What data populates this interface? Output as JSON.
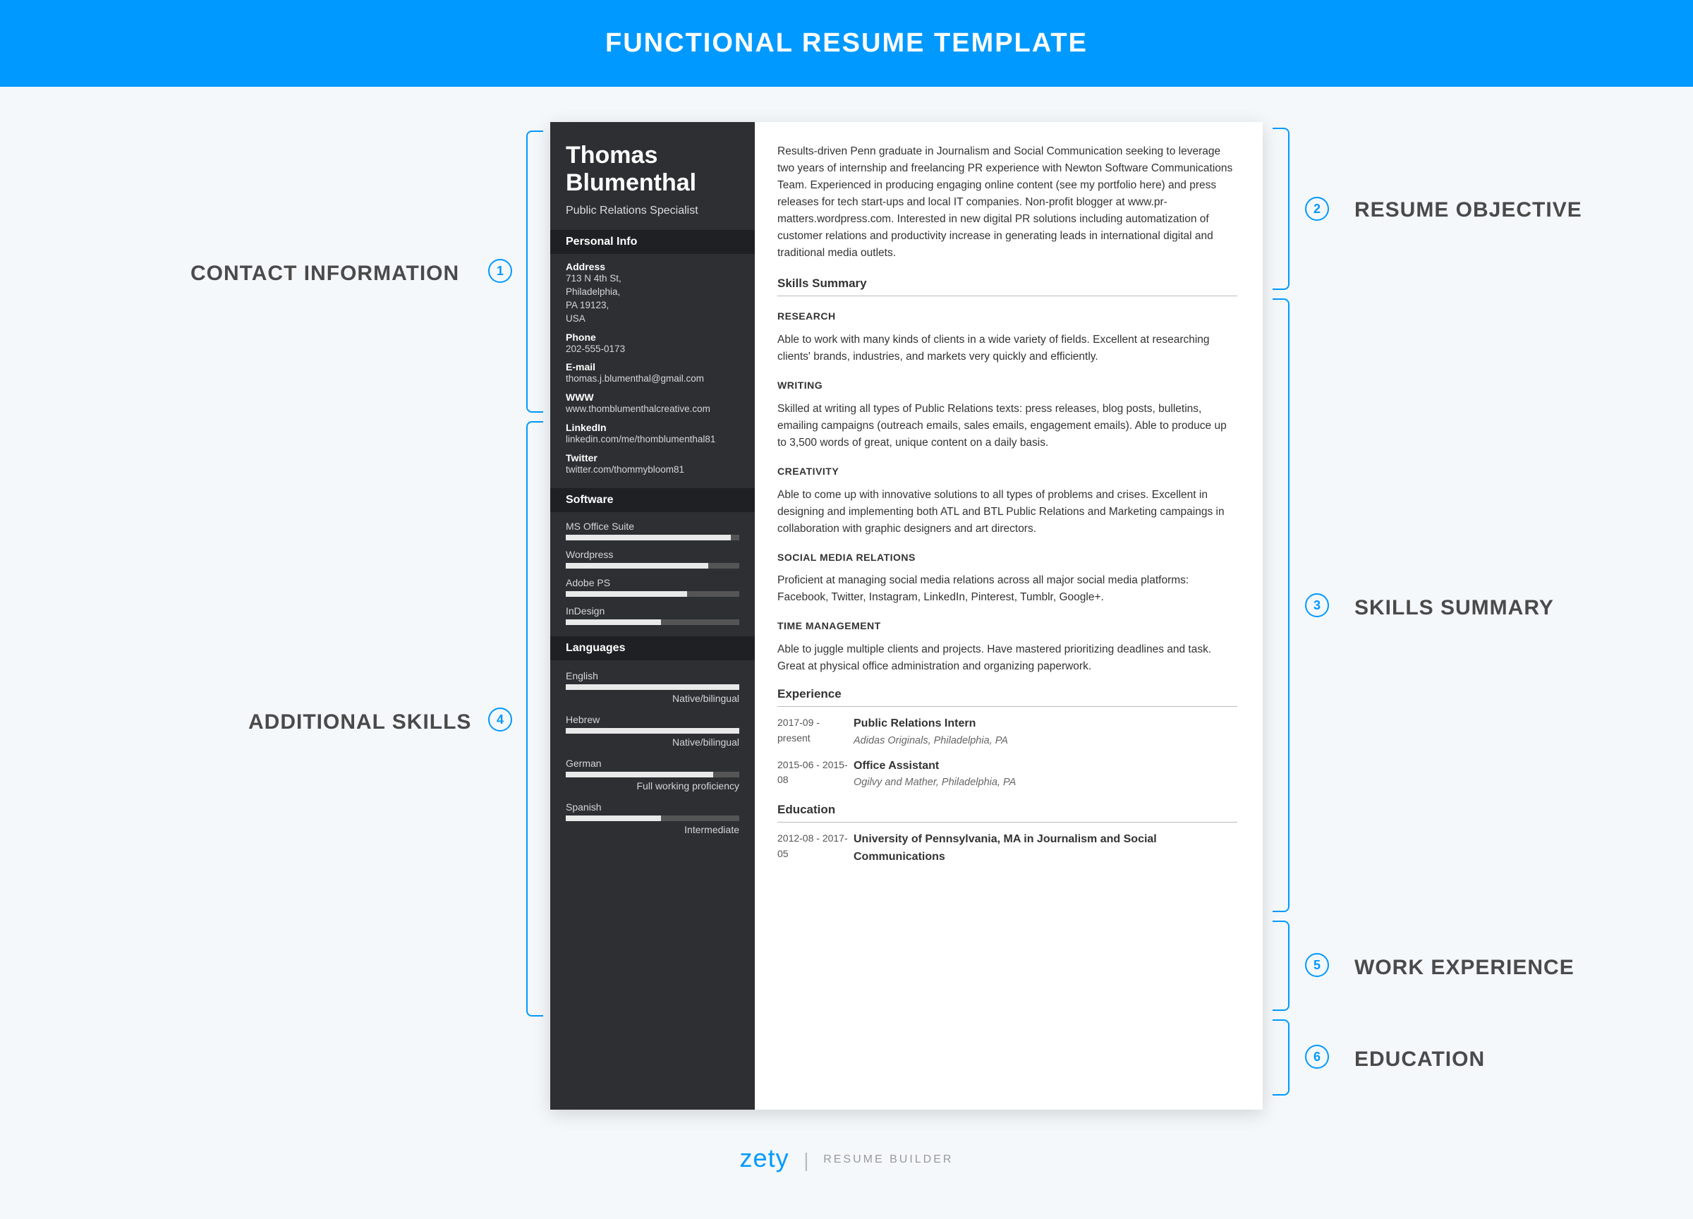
{
  "banner": "FUNCTIONAL RESUME TEMPLATE",
  "annotations": {
    "a1": "CONTACT INFORMATION",
    "a2": "RESUME OBJECTIVE",
    "a3": "SKILLS SUMMARY",
    "a4": "ADDITIONAL SKILLS",
    "a5": "WORK EXPERIENCE",
    "a6": "EDUCATION",
    "n1": "1",
    "n2": "2",
    "n3": "3",
    "n4": "4",
    "n5": "5",
    "n6": "6"
  },
  "sidebar": {
    "name": "Thomas Blumenthal",
    "role": "Public Relations Specialist",
    "personal_info_head": "Personal Info",
    "address_label": "Address",
    "address": "713 N 4th St,\nPhiladelphia,\nPA 19123,\nUSA",
    "phone_label": "Phone",
    "phone": "202-555-0173",
    "email_label": "E-mail",
    "email": "thomas.j.blumenthal@gmail.com",
    "www_label": "WWW",
    "www": "www.thomblumenthalcreative.com",
    "linkedin_label": "LinkedIn",
    "linkedin": "linkedin.com/me/thomblumenthal81",
    "twitter_label": "Twitter",
    "twitter": "twitter.com/thommybloom81",
    "software_head": "Software",
    "software": [
      {
        "name": "MS Office Suite",
        "pct": 95
      },
      {
        "name": "Wordpress",
        "pct": 82
      },
      {
        "name": "Adobe PS",
        "pct": 70
      },
      {
        "name": "InDesign",
        "pct": 55
      }
    ],
    "languages_head": "Languages",
    "languages": [
      {
        "name": "English",
        "level": "Native/bilingual",
        "pct": 100
      },
      {
        "name": "Hebrew",
        "level": "Native/bilingual",
        "pct": 100
      },
      {
        "name": "German",
        "level": "Full working proficiency",
        "pct": 85
      },
      {
        "name": "Spanish",
        "level": "Intermediate",
        "pct": 55
      }
    ]
  },
  "main": {
    "objective": "Results-driven Penn graduate in Journalism and Social Communication seeking to leverage two years of internship and freelancing PR experience with Newton Software Communications Team. Experienced in producing engaging online content (see my portfolio here) and press releases for tech start-ups and local IT companies. Non-profit blogger at www.pr-matters.wordpress.com. Interested in new digital PR solutions including automatization of customer relations and productivity increase in generating leads in international digital and traditional media outlets.",
    "skills_head": "Skills Summary",
    "skills": [
      {
        "h": "RESEARCH",
        "t": "Able to work with many kinds of clients in a wide variety of fields. Excellent at researching clients' brands, industries, and markets very quickly and efficiently."
      },
      {
        "h": "WRITING",
        "t": "Skilled at writing all types of Public Relations texts: press releases, blog posts, bulletins, emailing campaigns (outreach emails, sales emails, engagement emails). Able to produce up to 3,500 words of great, unique content on a daily basis."
      },
      {
        "h": "CREATIVITY",
        "t": "Able to come up with innovative solutions to all types of problems and crises. Excellent in designing and implementing both ATL and BTL Public Relations and Marketing campaings in collaboration with graphic designers and art directors."
      },
      {
        "h": "SOCIAL MEDIA RELATIONS",
        "t": "Proficient at managing social media relations across all major social media platforms: Facebook, Twitter, Instagram, LinkedIn, Pinterest, Tumblr, Google+."
      },
      {
        "h": "TIME MANAGEMENT",
        "t": "Able to juggle multiple clients and projects. Have mastered prioritizing deadlines and task. Great at physical office administration and organizing paperwork."
      }
    ],
    "exp_head": "Experience",
    "exp": [
      {
        "dates": "2017-09 - present",
        "title": "Public Relations Intern",
        "sub": "Adidas Originals, Philadelphia, PA"
      },
      {
        "dates": "2015-06 - 2015-08",
        "title": "Office Assistant",
        "sub": "Ogilvy and Mather, Philadelphia, PA"
      }
    ],
    "edu_head": "Education",
    "edu": [
      {
        "dates": "2012-08 - 2017-05",
        "title": "University of Pennsylvania, MA in Journalism and Social Communications"
      }
    ]
  },
  "footer": {
    "brand": "zety",
    "tag": "RESUME BUILDER"
  }
}
